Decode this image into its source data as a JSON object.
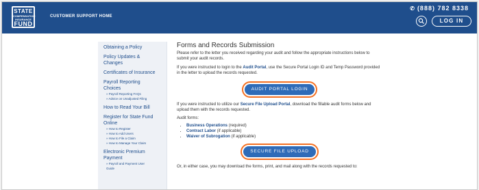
{
  "header": {
    "logo_line1": "STATE",
    "logo_line2": "COMPENSATION INSURANCE",
    "logo_line3": "FUND",
    "support_link": "CUSTOMER SUPPORT HOME",
    "phone": "(888) 782 8338",
    "login_label": "LOG IN"
  },
  "sidebar": {
    "items": [
      {
        "label": "Obtaining a Policy"
      },
      {
        "label": "Policy Updates &"
      },
      {
        "label": "Changes"
      },
      {
        "label": "Certificates of Insurance"
      },
      {
        "label": "Payroll Reporting"
      },
      {
        "label": "Choices"
      },
      {
        "label": "» Payroll Reporting FAQs"
      },
      {
        "label": "» Advice on Unadjusted Filing"
      },
      {
        "label": "How to Read Your Bill"
      },
      {
        "label": "Register for State Fund"
      },
      {
        "label": "Online"
      },
      {
        "label": "» How to Register"
      },
      {
        "label": "» How to Add Users"
      },
      {
        "label": "» How to File a Claim"
      },
      {
        "label": "» How to Manage Your Claim"
      },
      {
        "label": "Electronic Premium"
      },
      {
        "label": "Payment"
      },
      {
        "label": "» Payroll and Payment User"
      },
      {
        "label": "Guide"
      }
    ]
  },
  "main": {
    "title": "Forms and Records Submission",
    "intro": "Please refer to the letter you received regarding your audit and follow the appropriate instructions below to submit your audit records.",
    "portal_text_pre": "If you were instructed to login to the ",
    "portal_link": "Audit Portal",
    "portal_text_post": ", use the Secure Portal Login ID and Temp Password provided in the letter to upload the records requested.",
    "portal_button": "AUDIT PORTAL LOGIN",
    "sfu_text_pre": "If you were instructed to utilize our ",
    "sfu_link": "Secure File Upload Portal",
    "sfu_text_post": ", download the fillable audit forms below and upload them with the records requested.",
    "audit_forms_label": "Audit forms:",
    "forms": [
      {
        "link": "Business Operations",
        "note": " (required)"
      },
      {
        "link": "Contract Labor",
        "note": " (if applicable)"
      },
      {
        "link": "Waiver of Subrogation",
        "note": " (if applicable)"
      }
    ],
    "upload_button": "SECURE FILE UPLOAD",
    "footer_text": "Or, in either case, you may download the forms, print, and mail along with the records requested to:"
  },
  "colors": {
    "brand": "#1f4e8c",
    "button": "#2e6bb8",
    "highlight": "#f36f21"
  }
}
